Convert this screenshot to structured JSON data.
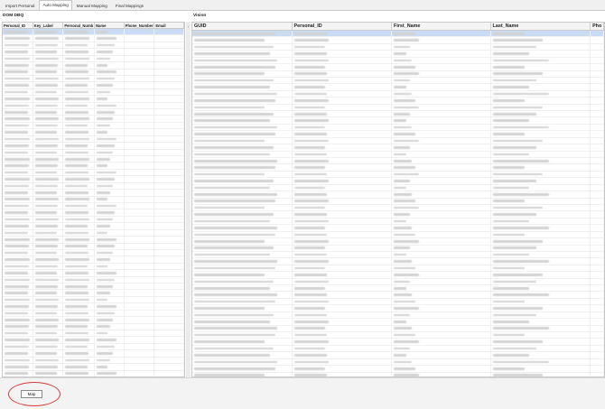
{
  "tabs": [
    {
      "label": "Import Personal",
      "active": false
    },
    {
      "label": "Auto Mapping",
      "active": true
    },
    {
      "label": "Manual Mapping",
      "active": false
    },
    {
      "label": "Final Mappings",
      "active": false
    }
  ],
  "left_panel": {
    "title": "DOM DBQ",
    "columns": [
      "Personal_ID",
      "Key_Label",
      "Personal_Numb",
      "Name",
      "Phone_Number",
      "Email"
    ]
  },
  "right_panel": {
    "title": "Vision",
    "columns": [
      "GUID",
      "Personal_ID",
      "First_Name",
      "Last_Name",
      "Pho"
    ]
  },
  "collapse_icon": "chevron-left-icon",
  "actions": {
    "map_label": "Map"
  },
  "colors": {
    "selection": "#c9dcf3",
    "highlight": "#d63b3b"
  }
}
